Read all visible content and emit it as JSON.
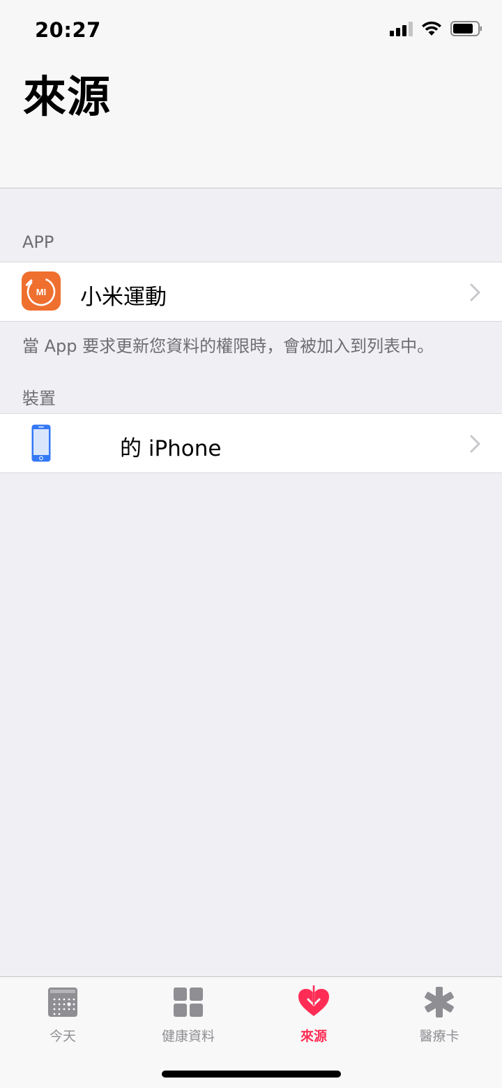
{
  "status_bar": {
    "time": "20:27"
  },
  "header": {
    "title": "來源"
  },
  "sections": {
    "apps": {
      "header": "APP",
      "item_label": "小米運動",
      "item_icon": "mi-fit-app-icon",
      "footer": "當 App 要求更新您資料的權限時，會被加入到列表中。"
    },
    "devices": {
      "header": "裝置",
      "item_label": "的 iPhone",
      "item_icon": "iphone-icon"
    }
  },
  "tabs": [
    {
      "label": "今天",
      "icon": "calendar-icon",
      "active": false
    },
    {
      "label": "健康資料",
      "icon": "grid-icon",
      "active": false
    },
    {
      "label": "來源",
      "icon": "heart-download-icon",
      "active": true
    },
    {
      "label": "醫療卡",
      "icon": "asterisk-icon",
      "active": false
    }
  ],
  "colors": {
    "accent": "#ff2d55",
    "mi_orange": "#ef6f2e",
    "iphone_blue": "#3478f6",
    "background": "#efeff4"
  }
}
